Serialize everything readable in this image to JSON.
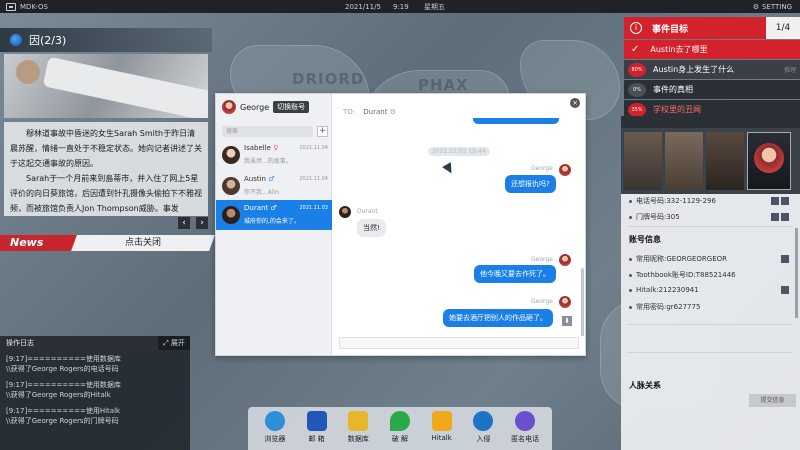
{
  "topbar": {
    "os_name": "MDK-OS",
    "date": "2021/11/5",
    "time": "9:19",
    "weekday": "星期五",
    "setting": "SETTING"
  },
  "map": {
    "regions": [
      "DRIORD",
      "PHAX"
    ]
  },
  "news": {
    "title": "因(2/3)",
    "paragraphs": [
      "穆林道事故中昏迷的女生Sarah Smith于昨日清晨苏醒，情绪一直处于不稳定状态。她向记者讲述了关于这起交通事故的原因。",
      "Sarah于一个月前来到島蒂市，并入住了网上5星评价的向日葵旅馆，后因遭到针孔摄像头偷拍下不雅视频，而被旅馆负责人Jon Thompson威胁。事发"
    ],
    "tag": "News",
    "close_label": "点击关闭",
    "prev": "‹",
    "next": "›"
  },
  "log": {
    "title": "操作日志",
    "expand_label": "展开",
    "lines": [
      "[9:17]==========使用数据库",
      "\\\\获得了George Rogers的电话号码",
      "[9:17]==========使用数据库",
      "\\\\获得了George Rogers的Hitalk",
      "[9:17]==========使用Hitalk",
      "\\\\获得了George Rogers的门牌号码"
    ]
  },
  "chat": {
    "me_name": "George",
    "switch_label": "切换账号",
    "search_placeholder": "搜索",
    "add": "+",
    "to_label": "TO:",
    "to_name": "Durant",
    "close": "×",
    "contacts": [
      {
        "name": "Isabelle",
        "gender": "♀",
        "date": "2021.11.04",
        "preview": "我虽然...的故事。"
      },
      {
        "name": "Austin",
        "gender": "♂",
        "date": "2021.11.04",
        "preview": "你不我...Alin"
      },
      {
        "name": "Durant",
        "gender": "♂",
        "date": "2021.11.03",
        "preview": "城府你的,的会来了。"
      }
    ],
    "timestamp": "2021.11.03 19:44",
    "messages": [
      {
        "sender": "George",
        "text": "还想报仇吗?"
      },
      {
        "sender": "Durant",
        "text": "当然!"
      },
      {
        "sender": "George",
        "text": "他今晚又要去作死了。"
      },
      {
        "sender": "George",
        "text": "她要去酒厅把别人的作品砸了。"
      }
    ]
  },
  "events": {
    "title": "事件目标",
    "count": "1/4",
    "items": [
      {
        "pct": "",
        "label": "Austin去了哪里",
        "tag": ""
      },
      {
        "pct": "80%",
        "label": "Austin身上发生了什么",
        "tag": "推理"
      },
      {
        "pct": "0%",
        "label": "事件的真相",
        "tag": ""
      },
      {
        "pct": "35%",
        "label": "学校里的丑闻",
        "tag": ""
      }
    ]
  },
  "profile": {
    "phone": "电话号码:332-1129-296",
    "door": "门牌号码:305",
    "account_head": "账号信息",
    "nickname": "常用昵称:GEORGEORGEOR",
    "toothbook": "Toothbook账号ID:T88521446",
    "hitalk": "Hitalk:212230941",
    "password": "常用密码:gr627775",
    "relations_head": "人脉关系",
    "submit_label": "提交信息"
  },
  "dock": {
    "apps": [
      {
        "label": "浏览器",
        "color": "#2d8fd5"
      },
      {
        "label": "邮 箱",
        "color": "#2057b8"
      },
      {
        "label": "数据库",
        "color": "#e8b62a"
      },
      {
        "label": "破 解",
        "color": "#2aa84a"
      },
      {
        "label": "Hitalk",
        "color": "#f0a81c"
      },
      {
        "label": "入侵",
        "color": "#1e73c7"
      },
      {
        "label": "匿名电话",
        "color": "#6a4fcf"
      }
    ]
  }
}
